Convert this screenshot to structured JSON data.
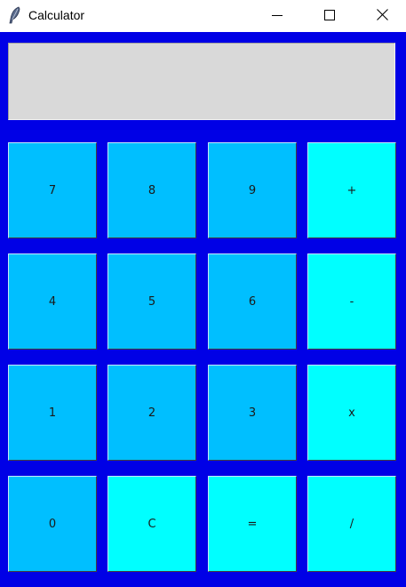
{
  "window": {
    "title": "Calculator",
    "icon": "feather-icon",
    "controls": [
      "minimize-icon",
      "maximize-icon",
      "close-icon"
    ]
  },
  "display": {
    "value": ""
  },
  "keys": {
    "k7": "7",
    "k8": "8",
    "k9": "9",
    "plus": "+",
    "k4": "4",
    "k5": "5",
    "k6": "6",
    "minus": "-",
    "k1": "1",
    "k2": "2",
    "k3": "3",
    "times": "x",
    "k0": "0",
    "clear": "C",
    "equals": "=",
    "divide": "/"
  },
  "colors": {
    "background": "#0000e6",
    "number_key": "#00bfff",
    "operator_key": "#00ffff",
    "display": "#d9d9d9"
  }
}
